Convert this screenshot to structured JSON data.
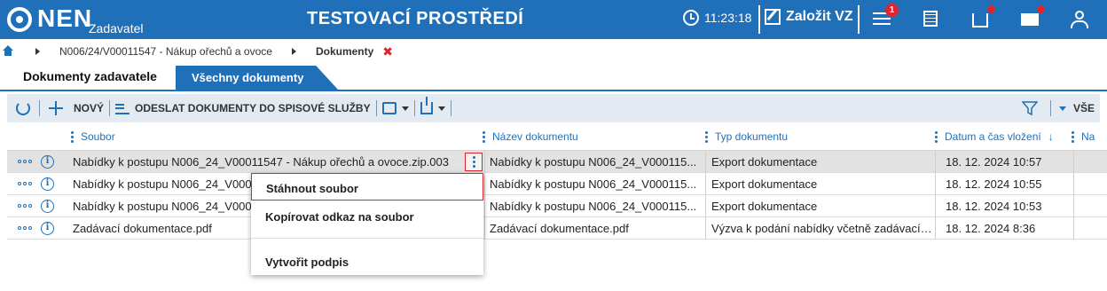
{
  "app": {
    "logo_text": "NEN",
    "logo_sub": "Zadavatel",
    "env_title": "TESTOVACÍ PROSTŘEDÍ",
    "time": "11:23:18",
    "create_label": "Založit VZ",
    "notif_count": "1",
    "accent": "#1f70b8",
    "alert": "#e0242b"
  },
  "breadcrumb": {
    "items": [
      "N006/24/V00011547 - Nákup ořechů a ovoce",
      "Dokumenty"
    ],
    "close_symbol": "✖"
  },
  "tabs": [
    {
      "label": "Dokumenty zadavatele",
      "active": true
    },
    {
      "label": "Všechny dokumenty",
      "active": false
    }
  ],
  "toolbar": {
    "new_label": "NOVÝ",
    "send_label": "ODESLAT DOKUMENTY DO SPISOVÉ SLUŽBY",
    "filter_label": "VŠE"
  },
  "table": {
    "columns": [
      "Soubor",
      "Název dokumentu",
      "Typ dokumentu",
      "Datum a čas vložení",
      "Na"
    ],
    "sort_arrow": "↓",
    "rows": [
      {
        "file": "Nabídky k postupu N006_24_V00011547 - Nákup ořechů a ovoce.zip.003",
        "name": "Nabídky k postupu N006_24_V000115...",
        "type": "Export dokumentace",
        "date": "18. 12. 2024 10:57"
      },
      {
        "file": "Nabídky k postupu N006_24_V0001",
        "name": "Nabídky k postupu N006_24_V000115...",
        "type": "Export dokumentace",
        "date": "18. 12. 2024 10:55"
      },
      {
        "file": "Nabídky k postupu N006_24_V0001",
        "name": "Nabídky k postupu N006_24_V000115...",
        "type": "Export dokumentace",
        "date": "18. 12. 2024 10:53"
      },
      {
        "file": "Zadávací dokumentace.pdf",
        "name": "Zadávací dokumentace.pdf",
        "type": "Výzva k podání nabídky včetně zadávací ...",
        "date": "18. 12. 2024 8:36"
      }
    ]
  },
  "context_menu": {
    "items": [
      "Stáhnout soubor",
      "Kopírovat odkaz na soubor",
      "Vytvořit podpis"
    ]
  }
}
